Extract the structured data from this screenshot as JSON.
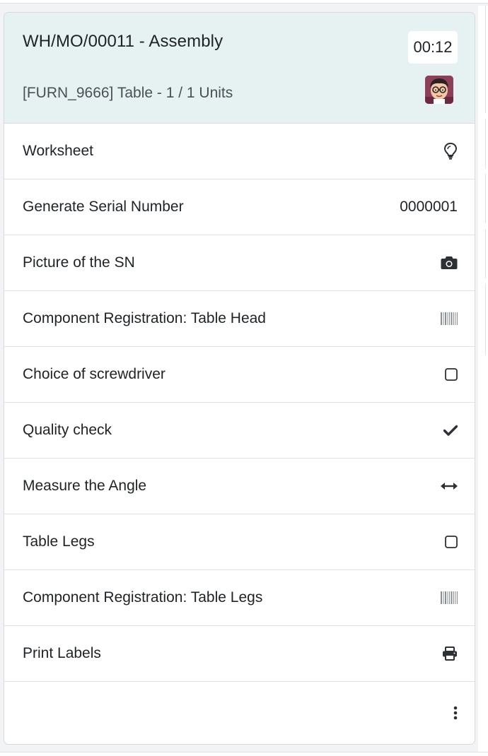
{
  "header": {
    "title": "WH/MO/00011 - Assembly",
    "timer": "00:12",
    "product": "[FURN_9666] Table - 1 / 1 Units",
    "avatar_icon": "user-avatar"
  },
  "steps": [
    {
      "label": "Worksheet",
      "icon": "lightbulb-icon"
    },
    {
      "label": "Generate Serial Number",
      "value": "0000001"
    },
    {
      "label": "Picture of the SN",
      "icon": "camera-icon"
    },
    {
      "label": "Component Registration: Table Head",
      "icon": "barcode-icon"
    },
    {
      "label": "Choice of screwdriver",
      "icon": "checkbox-empty-icon"
    },
    {
      "label": "Quality check",
      "icon": "checkmark-icon"
    },
    {
      "label": "Measure the Angle",
      "icon": "arrows-horizontal-icon"
    },
    {
      "label": "Table Legs",
      "icon": "checkbox-empty-icon"
    },
    {
      "label": "Component Registration: Table Legs",
      "icon": "barcode-icon"
    },
    {
      "label": "Print Labels",
      "icon": "printer-icon"
    }
  ],
  "footer": {
    "icon": "kebab-menu-icon"
  },
  "colors": {
    "header_bg": "#e6f1f2",
    "text": "#1f2326",
    "muted": "#4a5056",
    "border": "#dee2e6"
  }
}
